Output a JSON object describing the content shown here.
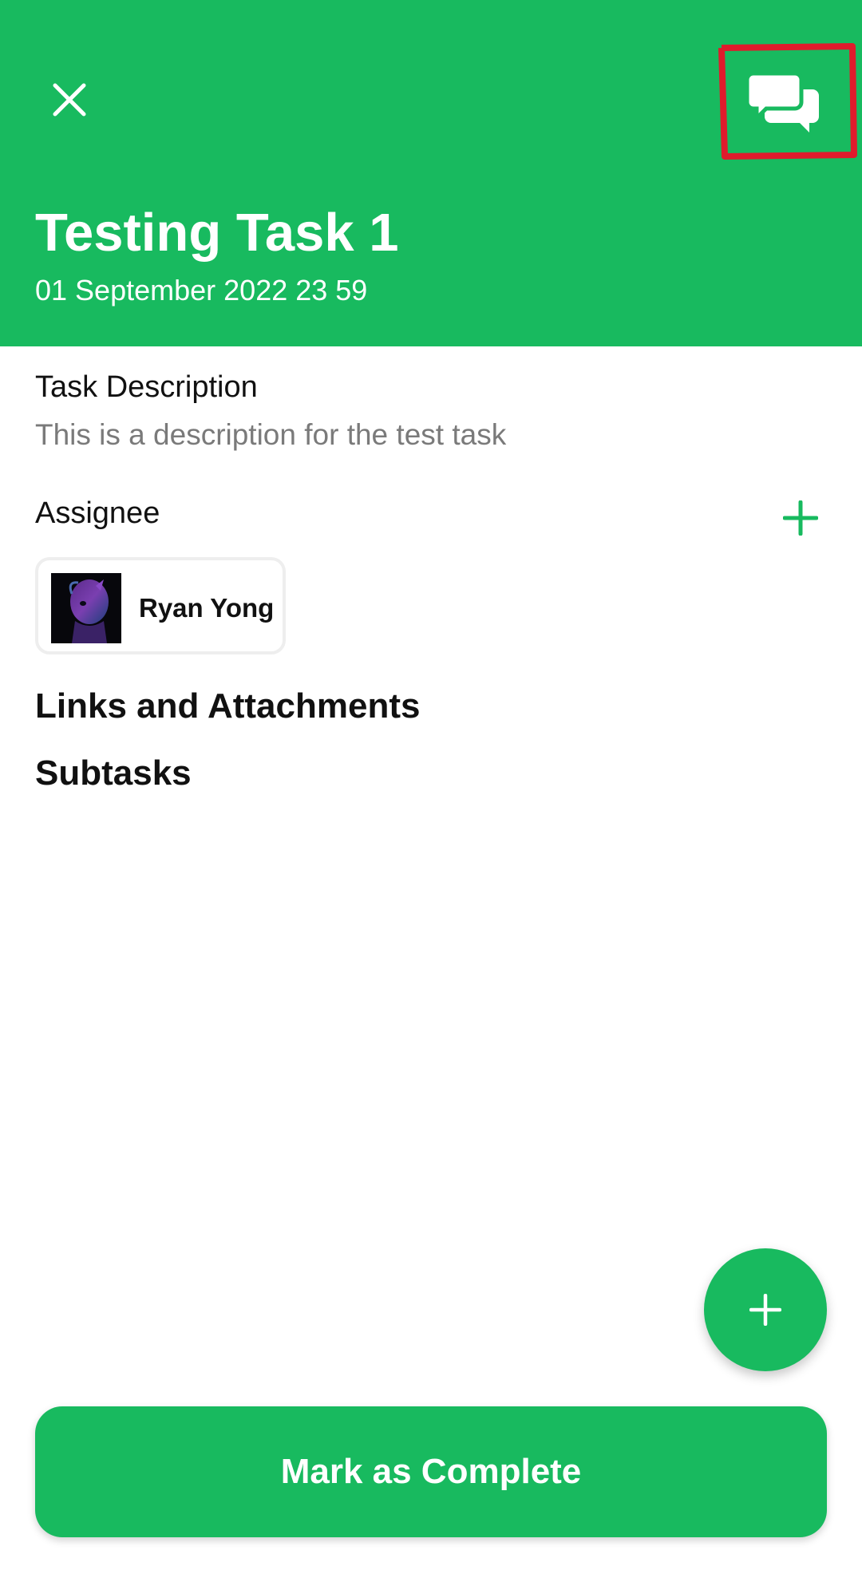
{
  "header": {
    "title": "Testing Task 1",
    "date": "01 September 2022 23 59",
    "close_icon": "close-icon",
    "chat_icon": "chat-bubbles-icon",
    "background_color": "#18BA5F",
    "highlight_color": "#E01B2C"
  },
  "description": {
    "label": "Task Description",
    "text": "This is a description for the test task"
  },
  "assignee": {
    "label": "Assignee",
    "add_icon": "plus-icon",
    "people": [
      {
        "name": "Ryan Yong",
        "avatar": "avatar-image"
      }
    ]
  },
  "links": {
    "heading": "Links and Attachments"
  },
  "subtasks": {
    "heading": "Subtasks"
  },
  "fab": {
    "icon": "plus-icon"
  },
  "footer": {
    "complete_label": "Mark as Complete"
  },
  "colors": {
    "accent": "#18BA5F",
    "text_primary": "#111111",
    "text_secondary": "#7A7A7A"
  }
}
